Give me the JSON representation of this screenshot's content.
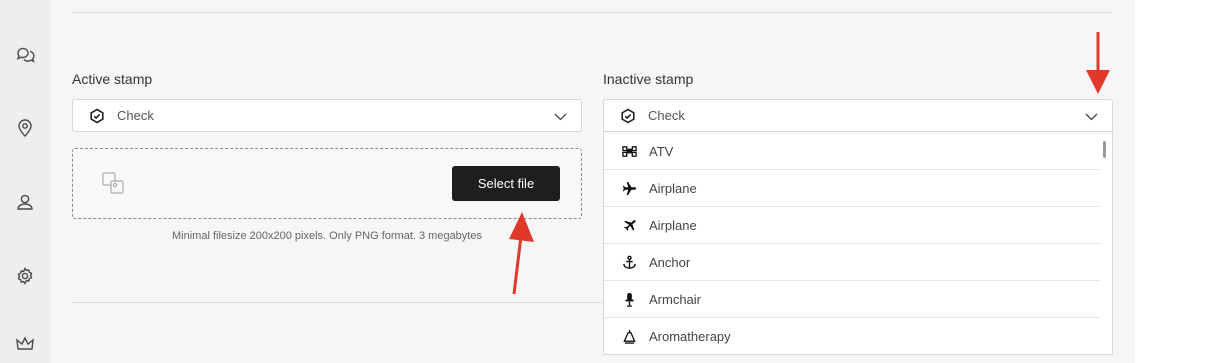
{
  "sidebar": {
    "items": [
      {
        "icon": "chat-icon"
      },
      {
        "icon": "location-pin-icon"
      },
      {
        "icon": "user-icon"
      },
      {
        "icon": "gear-icon"
      },
      {
        "icon": "crown-icon"
      }
    ]
  },
  "active_stamp": {
    "label": "Active stamp",
    "select_value": "Check",
    "select_icon": "check-badge-icon",
    "upload_button": "Select file",
    "hint": "Minimal filesize 200x200 pixels. Only PNG format. 3 megabytes"
  },
  "inactive_stamp": {
    "label": "Inactive stamp",
    "select_value": "Check",
    "select_icon": "check-badge-icon",
    "options": [
      {
        "label": "ATV",
        "icon": "atv-icon"
      },
      {
        "label": "Airplane",
        "icon": "airplane-icon"
      },
      {
        "label": "Airplane",
        "icon": "airplane-small-icon"
      },
      {
        "label": "Anchor",
        "icon": "anchor-icon"
      },
      {
        "label": "Armchair",
        "icon": "armchair-icon"
      },
      {
        "label": "Aromatherapy",
        "icon": "aromatherapy-icon"
      }
    ]
  },
  "colors": {
    "annotation_arrow": "#e0392b",
    "button_bg": "#1e1e1e"
  }
}
